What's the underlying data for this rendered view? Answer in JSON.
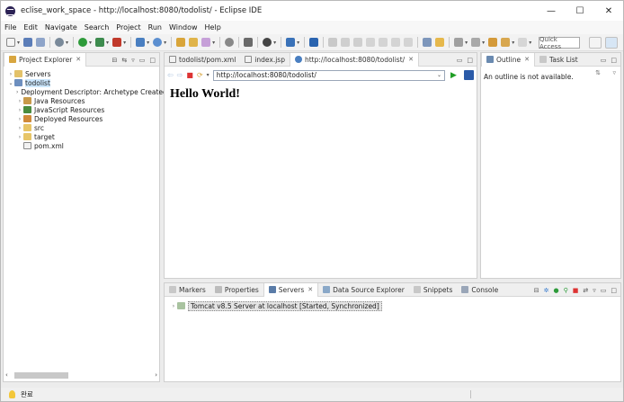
{
  "window": {
    "title": "eclise_work_space - http://localhost:8080/todolist/ - Eclipse IDE",
    "minimize": "—",
    "maximize": "☐",
    "close": "✕"
  },
  "menu": [
    "File",
    "Edit",
    "Navigate",
    "Search",
    "Project",
    "Run",
    "Window",
    "Help"
  ],
  "toolbar": {
    "quick_access": "Quick Access"
  },
  "project_explorer": {
    "tab_label": "Project Explorer",
    "tree": [
      {
        "label": "Servers",
        "level": 0,
        "expanded": false,
        "icon": "folder-icon"
      },
      {
        "label": "todolist",
        "level": 0,
        "expanded": true,
        "icon": "project-icon",
        "selected": true
      },
      {
        "label": "Deployment Descriptor: Archetype Created",
        "level": 1,
        "expanded": false,
        "icon": "descriptor-icon"
      },
      {
        "label": "Java Resources",
        "level": 1,
        "expanded": false,
        "icon": "java-resources-icon"
      },
      {
        "label": "JavaScript Resources",
        "level": 1,
        "expanded": false,
        "icon": "javascript-resources-icon"
      },
      {
        "label": "Deployed Resources",
        "level": 1,
        "expanded": false,
        "icon": "deployed-resources-icon"
      },
      {
        "label": "src",
        "level": 1,
        "expanded": false,
        "icon": "folder-icon"
      },
      {
        "label": "target",
        "level": 1,
        "expanded": false,
        "icon": "folder-icon"
      },
      {
        "label": "pom.xml",
        "level": 1,
        "expanded": null,
        "icon": "xml-file-icon"
      }
    ]
  },
  "editor": {
    "tabs": [
      "todolist/pom.xml",
      "index.jsp",
      "http://localhost:8080/todolist/"
    ],
    "active_tab": 2,
    "url": "http://localhost:8080/todolist/",
    "page_heading": "Hello World!"
  },
  "outline": {
    "tabs": [
      "Outline",
      "Task List"
    ],
    "message": "An outline is not available."
  },
  "bottom_panel": {
    "tabs": [
      "Markers",
      "Properties",
      "Servers",
      "Data Source Explorer",
      "Snippets",
      "Console"
    ],
    "active_tab": 2,
    "server_row": "Tomcat v8.5 Server at localhost  [Started, Synchronized]"
  },
  "status": {
    "text": "완료"
  }
}
